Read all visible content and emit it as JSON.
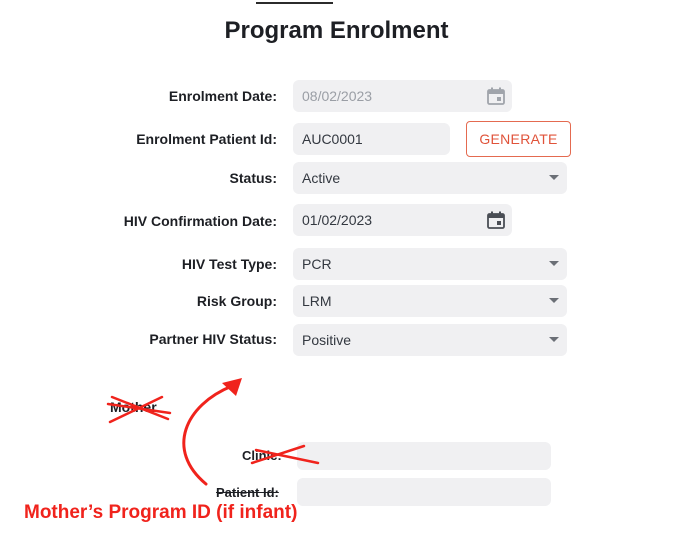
{
  "page": {
    "title": "Program Enrolment"
  },
  "form": {
    "enrolment_date": {
      "label": "Enrolment Date:",
      "value": "08/02/2023"
    },
    "enrolment_patient_id": {
      "label": "Enrolment Patient Id:",
      "value": "AUC0001",
      "generate_label": "GENERATE"
    },
    "status": {
      "label": "Status:",
      "value": "Active"
    },
    "hiv_confirmation_date": {
      "label": "HIV Confirmation Date:",
      "value": "01/02/2023"
    },
    "hiv_test_type": {
      "label": "HIV Test Type:",
      "value": "PCR"
    },
    "risk_group": {
      "label": "Risk Group:",
      "value": "LRM"
    },
    "partner_hiv_status": {
      "label": "Partner HIV Status:",
      "value": "Positive"
    }
  },
  "mother": {
    "heading": "Mother",
    "clinic_label": "Clinic:",
    "clinic_value": "",
    "patient_id_label": "Patient Id:",
    "patient_id_value": ""
  },
  "annotation": {
    "text": "Mother’s Program ID (if infant)",
    "color": "#f0231c"
  },
  "icons": {
    "calendar": "calendar-icon",
    "dropdown": "chevron-down-icon"
  },
  "colors": {
    "accent": "#e0533a",
    "field_bg": "#f0f0f2",
    "annotation": "#f0231c"
  }
}
